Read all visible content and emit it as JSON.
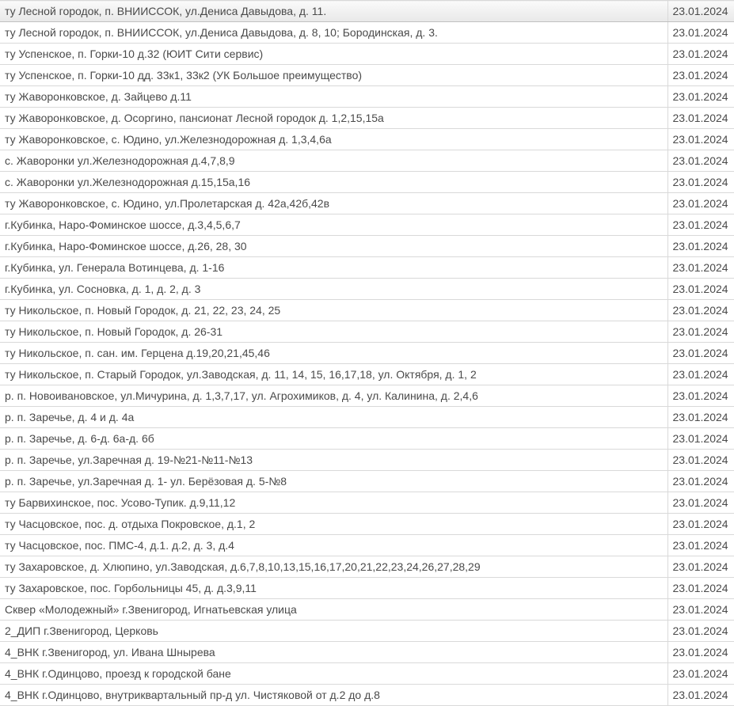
{
  "rows": [
    {
      "address": "ту Лесной городок, п. ВНИИССОК, ул.Дениса Давыдова, д. 11.",
      "date": "23.01.2024",
      "header": true
    },
    {
      "address": "ту Лесной городок, п. ВНИИССОК, ул.Дениса Давыдова, д. 8, 10; Бородинская, д. 3.",
      "date": "23.01.2024"
    },
    {
      "address": "ту Успенское, п. Горки-10 д.32 (ЮИТ Сити сервис)",
      "date": "23.01.2024"
    },
    {
      "address": "ту Успенское, п. Горки-10 дд. 33к1, 33к2 (УК Большое преимущество)",
      "date": "23.01.2024"
    },
    {
      "address": "ту Жаворонковское, д. Зайцево д.11",
      "date": "23.01.2024"
    },
    {
      "address": "ту Жаворонковское, д. Осоргино, пансионат Лесной городок д. 1,2,15,15а",
      "date": "23.01.2024"
    },
    {
      "address": "ту Жаворонковское, с. Юдино, ул.Железнодорожная д. 1,3,4,6а",
      "date": "23.01.2024"
    },
    {
      "address": "с. Жаворонки ул.Железнодорожная д.4,7,8,9",
      "date": "23.01.2024"
    },
    {
      "address": "с. Жаворонки ул.Железнодорожная д.15,15а,16",
      "date": "23.01.2024"
    },
    {
      "address": "ту Жаворонковское, с. Юдино, ул.Пролетарская д. 42а,42б,42в",
      "date": "23.01.2024"
    },
    {
      "address": "г.Кубинка, Наро-Фоминское шоссе, д.3,4,5,6,7",
      "date": "23.01.2024"
    },
    {
      "address": "г.Кубинка, Наро-Фоминское шоссе, д.26, 28, 30",
      "date": "23.01.2024"
    },
    {
      "address": "г.Кубинка, ул. Генерала Вотинцева, д. 1-16",
      "date": "23.01.2024"
    },
    {
      "address": "г.Кубинка, ул. Сосновка, д. 1, д. 2, д. 3",
      "date": "23.01.2024"
    },
    {
      "address": "ту Никольское, п. Новый Городок, д. 21, 22, 23, 24, 25",
      "date": "23.01.2024"
    },
    {
      "address": "ту Никольское, п. Новый Городок, д. 26-31",
      "date": "23.01.2024"
    },
    {
      "address": "ту Никольское, п. сан. им. Герцена д.19,20,21,45,46",
      "date": "23.01.2024"
    },
    {
      "address": "ту Никольское, п. Старый Городок, ул.Заводская, д. 11, 14, 15, 16,17,18, ул. Октября, д. 1, 2",
      "date": "23.01.2024"
    },
    {
      "address": "р. п. Новоивановское, ул.Мичурина, д. 1,3,7,17, ул. Агрохимиков, д. 4, ул. Калинина, д. 2,4,6",
      "date": "23.01.2024"
    },
    {
      "address": "р. п. Заречье, д. 4 и д. 4а",
      "date": "23.01.2024"
    },
    {
      "address": "р. п. Заречье, д. 6-д. 6а-д. 6б",
      "date": "23.01.2024"
    },
    {
      "address": "р. п. Заречье, ул.Заречная д. 19-№21-№11-№13",
      "date": "23.01.2024"
    },
    {
      "address": "р. п. Заречье, ул.Заречная д. 1- ул. Берёзовая д. 5-№8",
      "date": "23.01.2024"
    },
    {
      "address": "ту Барвихинское, пос. Усово-Тупик. д.9,11,12",
      "date": "23.01.2024"
    },
    {
      "address": "ту Часцовское, пос. д. отдыха Покровское, д.1, 2",
      "date": "23.01.2024"
    },
    {
      "address": "ту Часцовское, пос. ПМС-4, д.1. д.2, д. 3, д.4",
      "date": "23.01.2024"
    },
    {
      "address": "ту Захаровское, д. Хлюпино, ул.Заводская, д.6,7,8,10,13,15,16,17,20,21,22,23,24,26,27,28,29",
      "date": "23.01.2024"
    },
    {
      "address": "ту Захаровское, пос. Горбольницы 45, д. д.3,9,11",
      "date": "23.01.2024"
    },
    {
      "address": "Сквер «Молодежный» г.Звенигород, Игнатьевская улица",
      "date": "23.01.2024"
    },
    {
      "address": "2_ДИП г.Звенигород, Церковь",
      "date": "23.01.2024"
    },
    {
      "address": "4_ВНК г.Звенигород, ул. Ивана Шнырева",
      "date": "23.01.2024"
    },
    {
      "address": "4_ВНК г.Одинцово, проезд к городской бане",
      "date": "23.01.2024"
    },
    {
      "address": "4_ВНК г.Одинцово, внутриквартальный пр-д ул. Чистяковой от д.2 до д.8",
      "date": "23.01.2024"
    }
  ]
}
